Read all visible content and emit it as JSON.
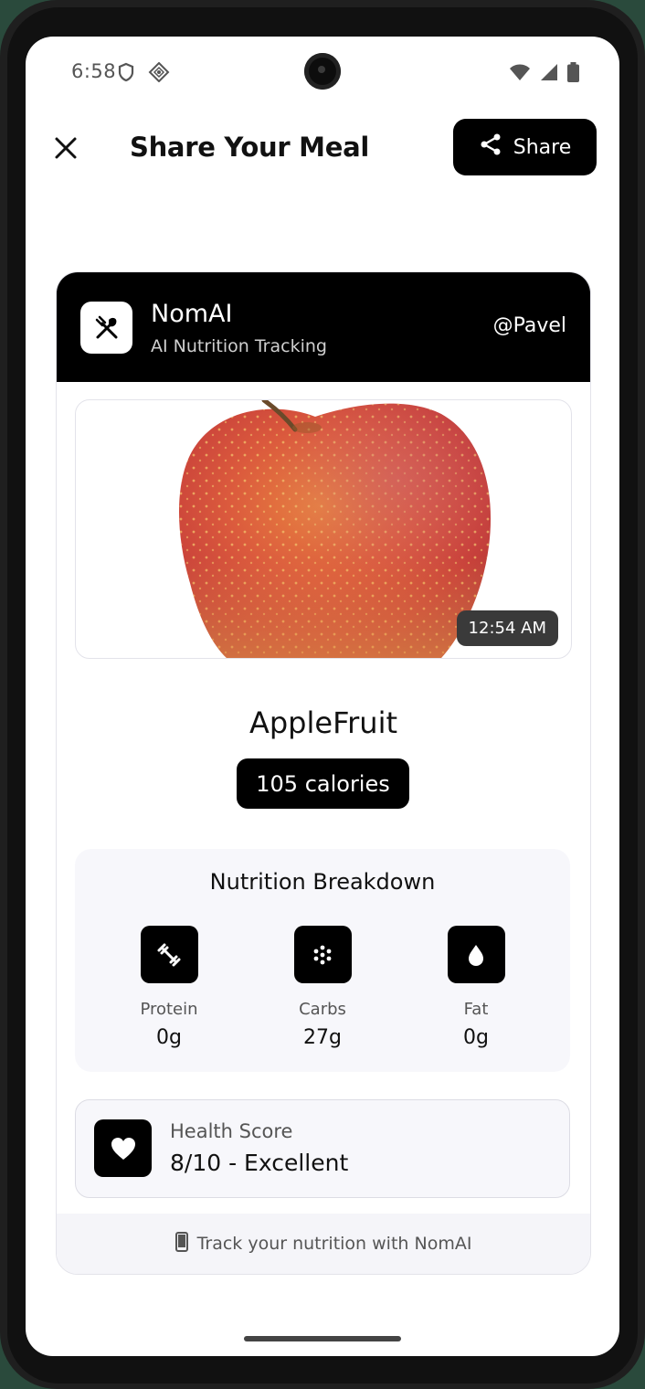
{
  "status_bar": {
    "time": "6:58",
    "icons": [
      "shield-icon",
      "data-saver-icon",
      "wifi-icon",
      "signal-icon",
      "battery-icon"
    ]
  },
  "header": {
    "title": "Share Your Meal",
    "share_label": "Share",
    "close_icon": "close-icon"
  },
  "card": {
    "brand": "NomAI",
    "tagline": "AI Nutrition Tracking",
    "username": "@Pavel",
    "photo_time": "12:54 AM",
    "meal_name": "AppleFruit",
    "calories": "105 calories",
    "nutrition": {
      "title": "Nutrition Breakdown",
      "items": [
        {
          "label": "Protein",
          "value": "0g",
          "icon": "dumbbell-icon"
        },
        {
          "label": "Carbs",
          "value": "27g",
          "icon": "grain-icon"
        },
        {
          "label": "Fat",
          "value": "0g",
          "icon": "drop-icon"
        }
      ]
    },
    "health": {
      "label": "Health Score",
      "value": "8/10 - Excellent"
    },
    "footer": "Track your nutrition with NomAI"
  },
  "colors": {
    "accent": "#000000",
    "surface": "#f7f7fb",
    "apple_red": "#d9523e"
  }
}
